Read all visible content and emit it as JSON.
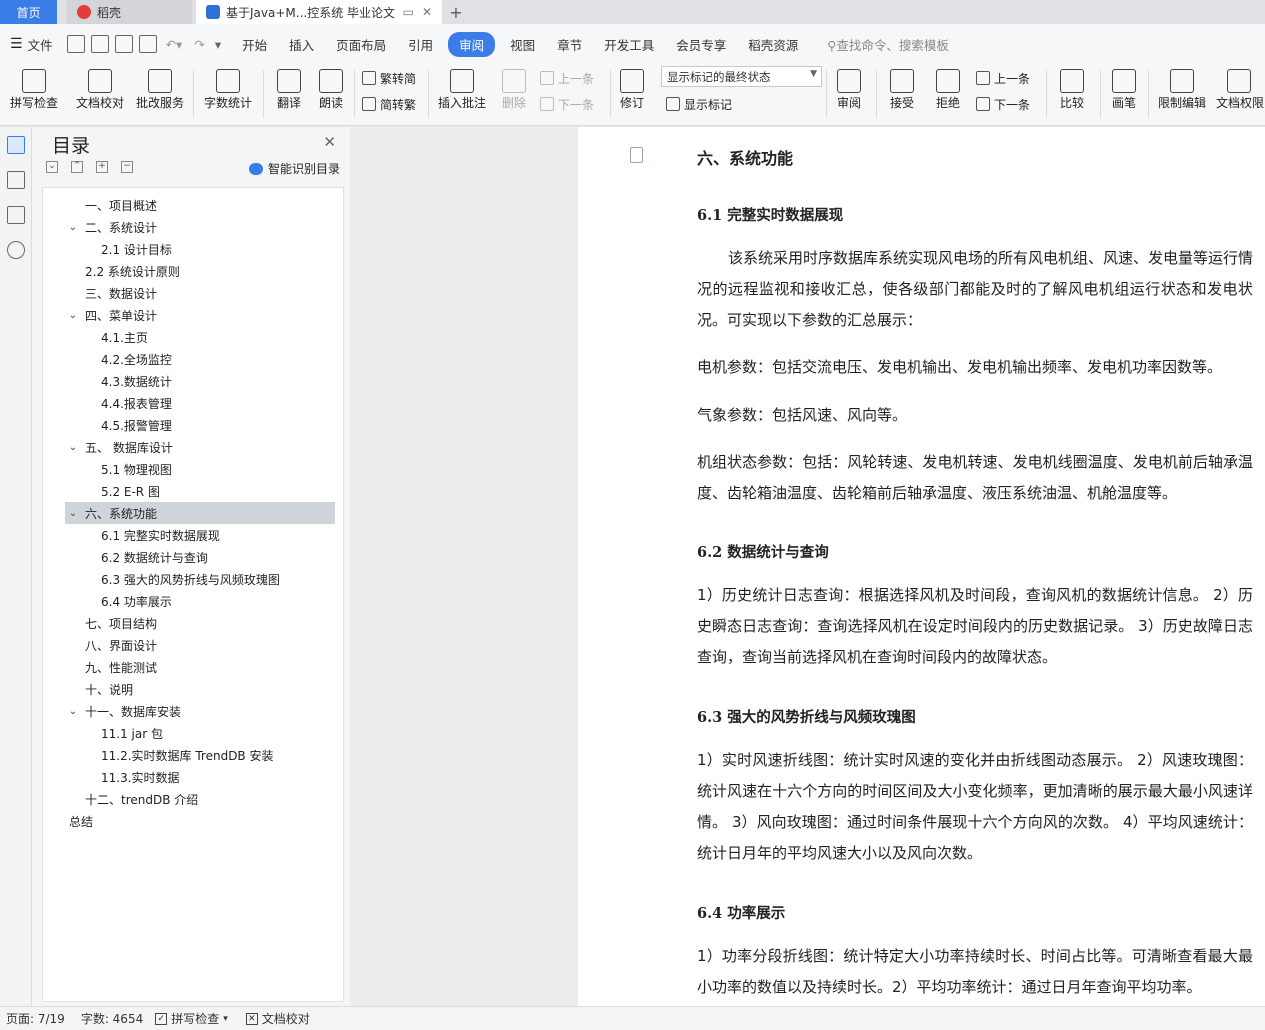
{
  "tabs": {
    "home": "首页",
    "daoke": "稻壳",
    "doc": "基于Java+M...控系统 毕业论文"
  },
  "menu": {
    "file": "文件",
    "items": [
      "开始",
      "插入",
      "页面布局",
      "引用",
      "审阅",
      "视图",
      "章节",
      "开发工具",
      "会员专享",
      "稻壳资源"
    ],
    "active": "审阅",
    "search": "查找命令、搜索模板"
  },
  "ribbon": {
    "spell": "拼写检查",
    "proof": "文档校对",
    "revise_service": "批改服务",
    "word_count": "字数统计",
    "translate": "翻译",
    "read_aloud": "朗读",
    "to_traditional": "繁转简",
    "to_simplified": "简转繁",
    "insert_comment": "插入批注",
    "delete": "删除",
    "prev": "上一条",
    "next": "下一条",
    "track": "修订",
    "markup_mode": "显示标记的最终状态",
    "show_markup": "显示标记",
    "review": "审阅",
    "accept": "接受",
    "reject": "拒绝",
    "prev2": "上一条",
    "next2": "下一条",
    "compare": "比较",
    "pen": "画笔",
    "restrict": "限制编辑",
    "doc_perm": "文档权限"
  },
  "toc": {
    "title": "目录",
    "smart": "智能识别目录",
    "items": [
      {
        "t": "一、项目概述",
        "lvl": 1
      },
      {
        "t": "二、系统设计",
        "lvl": 1,
        "exp": true
      },
      {
        "t": "2.1  设计目标",
        "lvl": 2
      },
      {
        "t": "2.2  系统设计原则",
        "lvl": 1
      },
      {
        "t": "三、数据设计",
        "lvl": 1
      },
      {
        "t": "四、菜单设计",
        "lvl": 1,
        "exp": true
      },
      {
        "t": "4.1.主页",
        "lvl": 2
      },
      {
        "t": "4.2.全场监控",
        "lvl": 2
      },
      {
        "t": "4.3.数据统计",
        "lvl": 2
      },
      {
        "t": "4.4.报表管理",
        "lvl": 2
      },
      {
        "t": "4.5.报警管理",
        "lvl": 2
      },
      {
        "t": "五、   数据库设计",
        "lvl": 1,
        "exp": true
      },
      {
        "t": "5.1  物理视图",
        "lvl": 2
      },
      {
        "t": "5.2 E-R  图",
        "lvl": 2
      },
      {
        "t": "六、系统功能",
        "lvl": 1,
        "exp": true,
        "sel": true
      },
      {
        "t": "6.1  完整实时数据展现",
        "lvl": 2
      },
      {
        "t": "6.2  数据统计与查询",
        "lvl": 2
      },
      {
        "t": "6.3  强大的风势折线与风频玫瑰图",
        "lvl": 2
      },
      {
        "t": "6.4  功率展示",
        "lvl": 2
      },
      {
        "t": "七、项目结构",
        "lvl": 1
      },
      {
        "t": "八、界面设计",
        "lvl": 1
      },
      {
        "t": "九、性能测试",
        "lvl": 1
      },
      {
        "t": "十、说明",
        "lvl": 1
      },
      {
        "t": "十一、数据库安装",
        "lvl": 1,
        "exp": true
      },
      {
        "t": "11.1 jar 包",
        "lvl": 2
      },
      {
        "t": "11.2.实时数据库 TrendDB  安装",
        "lvl": 2
      },
      {
        "t": "11.3.实时数据",
        "lvl": 2
      },
      {
        "t": "十二、trendDB 介绍",
        "lvl": 1
      },
      {
        "t": "总结",
        "lvl": 0
      }
    ]
  },
  "doc": {
    "h1": "六、系统功能",
    "s61": "6.1  完整实时数据展现",
    "p1": "该系统采用时序数据库系统实现风电场的所有风电机组、风速、发电量等运行情况的远程监视和接收汇总，使各级部门都能及时的了解风电机组运行状态和发电状况。可实现以下参数的汇总展示：",
    "p2": "电机参数：包括交流电压、发电机输出、发电机输出频率、发电机功率因数等。",
    "p3": "气象参数：包括风速、风向等。",
    "p4": "机组状态参数：包括：风轮转速、发电机转速、发电机线圈温度、发电机前后轴承温度、齿轮箱油温度、齿轮箱前后轴承温度、液压系统油温、机舱温度等。",
    "s62": "6.2  数据统计与查询",
    "p5": "1）历史统计日志查询：根据选择风机及时间段，查询风机的数据统计信息。 2）历史瞬态日志查询：查询选择风机在设定时间段内的历史数据记录。 3）历史故障日志查询，查询当前选择风机在查询时间段内的故障状态。",
    "s63": "6.3  强大的风势折线与风频玫瑰图",
    "p6": "1）实时风速折线图：统计实时风速的变化并由折线图动态展示。 2）风速玫瑰图：统计风速在十六个方向的时间区间及大小变化频率，更加清晰的展示最大最小风速详情。 3）风向玫瑰图：通过时间条件展现十六个方向风的次数。 4）平均风速统计：统计日月年的平均风速大小以及风向次数。",
    "s64": "6.4  功率展示",
    "p7": "1）功率分段折线图：统计特定大小功率持续时长、时间占比等。可清晰查看最大最小功率的数值以及持续时长。2）平均功率统计：通过日月年查询平均功率。"
  },
  "status": {
    "page": "页面: 7/19",
    "words": "字数: 4654",
    "spell": "拼写检查",
    "proof": "文档校对"
  }
}
